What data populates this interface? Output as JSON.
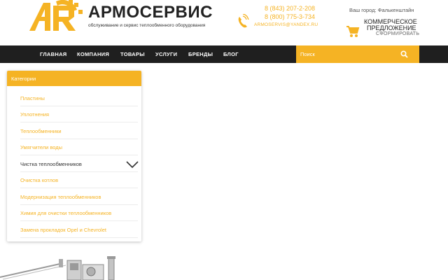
{
  "header": {
    "brand_name": "АРМОСЕРВИС",
    "brand_tagline": "обслуживание и сервис теплообменного оборудования",
    "phone_1": "8 (843) 207-2-208",
    "phone_2": "8 (800) 775-3-734",
    "email": "ARMOSERVIS@YANDEX.RU",
    "city": "Ваш город: Фалькенштайн",
    "commercial_offer_line1": "КОММЕРЧЕСКОЕ",
    "commercial_offer_line2": "ПРЕДЛОЖЕНИЕ",
    "commercial_offer_action": "СФОРМИРОВАТЬ"
  },
  "nav": {
    "items": [
      {
        "label": "ГЛАВНАЯ"
      },
      {
        "label": "КОМПАНИЯ"
      },
      {
        "label": "ТОВАРЫ"
      },
      {
        "label": "УСЛУГИ"
      },
      {
        "label": "БРЕНДЫ"
      },
      {
        "label": "БЛОГ"
      }
    ],
    "search_placeholder": "Поиск"
  },
  "categories": {
    "title": "Категории",
    "items": [
      {
        "label": "Пластины"
      },
      {
        "label": "Уплотнения"
      },
      {
        "label": "Теплообменники"
      },
      {
        "label": "Умягчители воды"
      },
      {
        "label": "Чистка теплообменников"
      },
      {
        "label": "Очистка котлов"
      },
      {
        "label": "Модернизация теплообменников"
      },
      {
        "label": "Химия для очистки теплообменников"
      },
      {
        "label": "Замена прокладок Opel и Chevrolet"
      }
    ]
  },
  "colors": {
    "accent": "#f5b324",
    "nav_background": "#1f1f1f",
    "text_dark": "#222222"
  },
  "icons": {
    "logo": "ar-gear-logo-icon",
    "phone": "phone-ringing-icon",
    "cart": "cart-icon",
    "search": "search-icon",
    "chevron": "chevron-down-icon"
  }
}
